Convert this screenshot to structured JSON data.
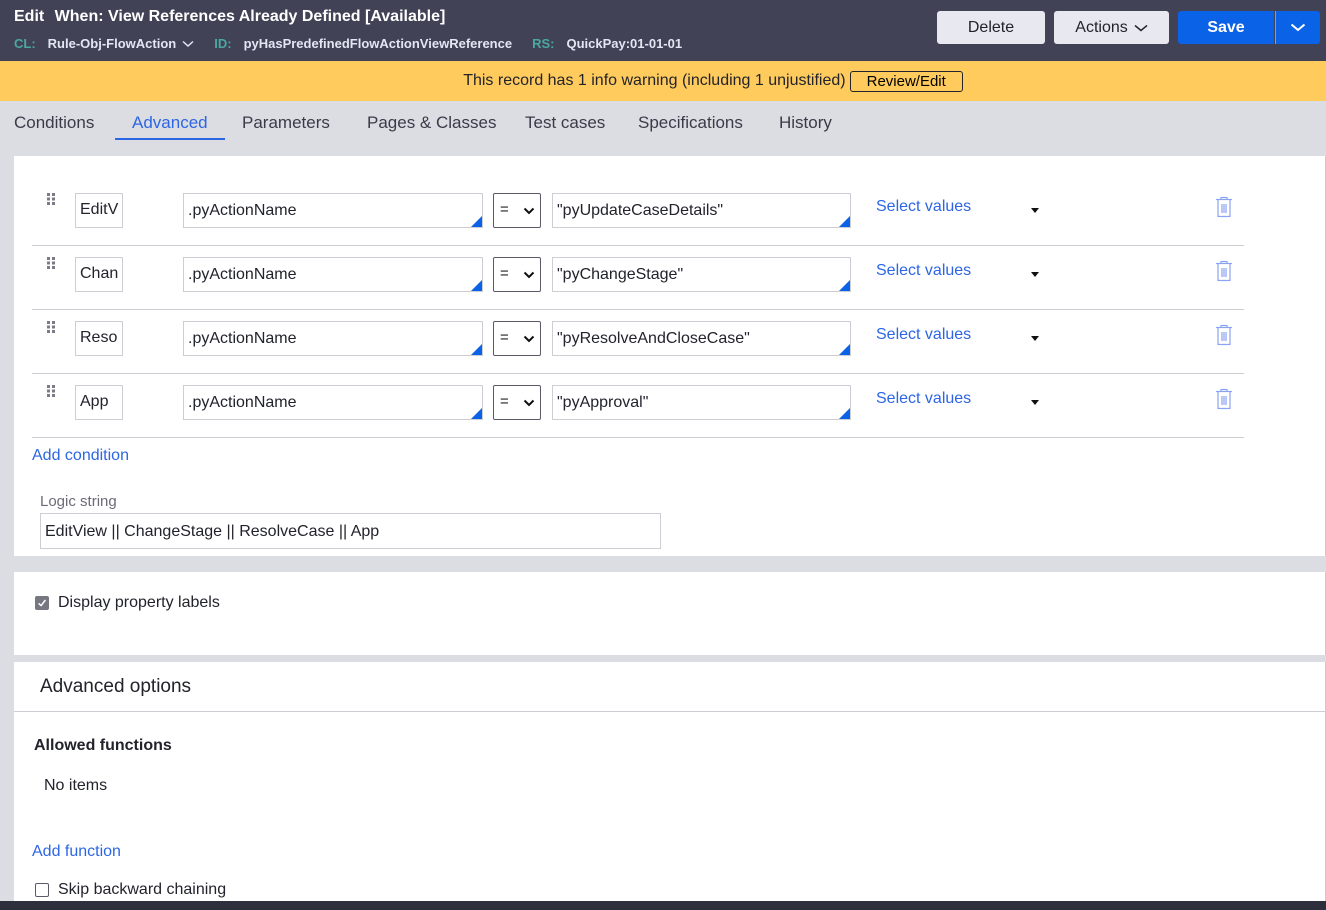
{
  "header": {
    "edit_label": "Edit",
    "title": "When: View References Already Defined [Available]",
    "meta": [
      {
        "key": "CL:",
        "value": "Rule-Obj-FlowAction",
        "has_dropdown": true
      },
      {
        "key": "ID:",
        "value": "pyHasPredefinedFlowActionViewReference"
      },
      {
        "key": "RS:",
        "value": "QuickPay:01-01-01"
      }
    ],
    "buttons": {
      "delete": "Delete",
      "actions": "Actions",
      "save": "Save"
    }
  },
  "warning": {
    "text": "This record has 1 info warning (including 1 unjustified)",
    "button": "Review/Edit",
    "color": "#ffcb5c"
  },
  "tabs": [
    {
      "label": "Conditions",
      "active": false
    },
    {
      "label": "Advanced",
      "active": true
    },
    {
      "label": "Parameters",
      "active": false
    },
    {
      "label": "Pages & Classes",
      "active": false
    },
    {
      "label": "Test cases",
      "active": false
    },
    {
      "label": "Specifications",
      "active": false
    },
    {
      "label": "History",
      "active": false
    }
  ],
  "conditions": {
    "rows": [
      {
        "label": "EditV",
        "property": ".pyActionName",
        "operator": "=",
        "value": "\"pyUpdateCaseDetails\"",
        "select_values": "Select values"
      },
      {
        "label": "Chan",
        "property": ".pyActionName",
        "operator": "=",
        "value": "\"pyChangeStage\"",
        "select_values": "Select values"
      },
      {
        "label": "Reso",
        "property": ".pyActionName",
        "operator": "=",
        "value": "\"pyResolveAndCloseCase\"",
        "select_values": "Select values"
      },
      {
        "label": "App",
        "property": ".pyActionName",
        "operator": "=",
        "value": "\"pyApproval\"",
        "select_values": "Select values"
      }
    ],
    "add_condition": "Add condition",
    "logic_label": "Logic string",
    "logic_value": "EditView || ChangeStage || ResolveCase || App"
  },
  "display": {
    "checkbox_label": "Display property labels",
    "checked": true
  },
  "advanced": {
    "title": "Advanced options",
    "allowed_functions_title": "Allowed functions",
    "no_items": "No items",
    "add_function": "Add function",
    "skip_label": "Skip backward chaining",
    "skip_checked": false
  },
  "colors": {
    "header_bg": "#414256",
    "accent": "#0a62e6",
    "link": "#2c66e4",
    "meta_key": "#4ba7a0"
  }
}
